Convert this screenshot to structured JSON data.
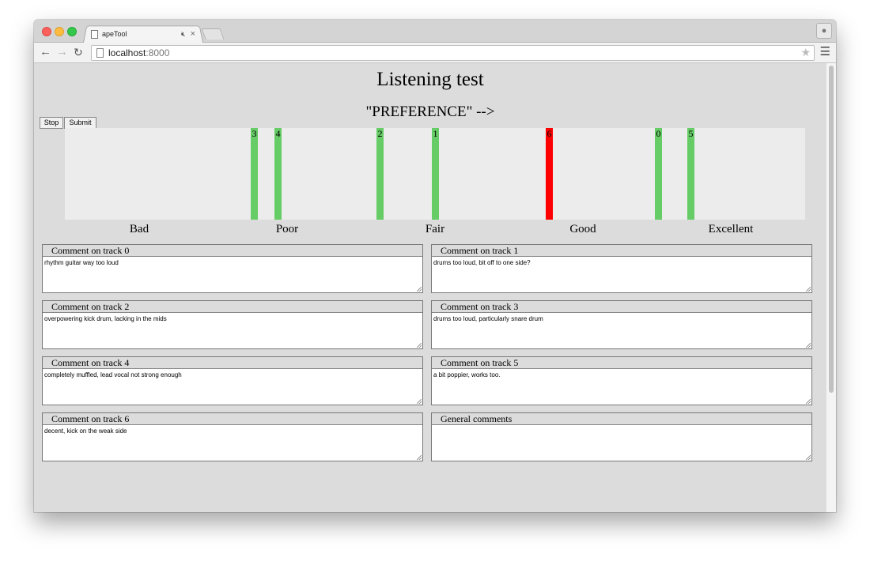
{
  "browser": {
    "tab_title": "apeTool",
    "mute_icon": "speaker-mute-icon",
    "close_glyph": "×",
    "url_host": "localhost",
    "url_port": ":8000"
  },
  "page": {
    "title": "Listening test",
    "preference_label": "\"PREFERENCE\" -->",
    "stop_label": "Stop",
    "submit_label": "Submit"
  },
  "colors": {
    "marker_default": "#66cc66",
    "marker_selected": "#ff0000"
  },
  "scale_labels": [
    "Bad",
    "Poor",
    "Fair",
    "Good",
    "Excellent"
  ],
  "markers": [
    {
      "label": "3",
      "rating": 0.256,
      "selected": false
    },
    {
      "label": "4",
      "rating": 0.288,
      "selected": false
    },
    {
      "label": "2",
      "rating": 0.426,
      "selected": false
    },
    {
      "label": "1",
      "rating": 0.5,
      "selected": false
    },
    {
      "label": "6",
      "rating": 0.654,
      "selected": true
    },
    {
      "label": "0",
      "rating": 0.802,
      "selected": false
    },
    {
      "label": "5",
      "rating": 0.846,
      "selected": false
    }
  ],
  "comments": [
    {
      "title": "Comment on track 0",
      "text": "rhythm guitar way too loud"
    },
    {
      "title": "Comment on track 1",
      "text": "drums too loud, bit off to one side?"
    },
    {
      "title": "Comment on track 2",
      "text": "overpowering kick drum, lacking in the mids"
    },
    {
      "title": "Comment on track 3",
      "text": "drums too loud, particularly snare drum"
    },
    {
      "title": "Comment on track 4",
      "text": "completely muffled, lead vocal not strong enough"
    },
    {
      "title": "Comment on track 5",
      "text": "a bit poppier, works too."
    },
    {
      "title": "Comment on track 6",
      "text": "decent, kick on the weak side"
    },
    {
      "title": "General comments",
      "text": ""
    }
  ]
}
